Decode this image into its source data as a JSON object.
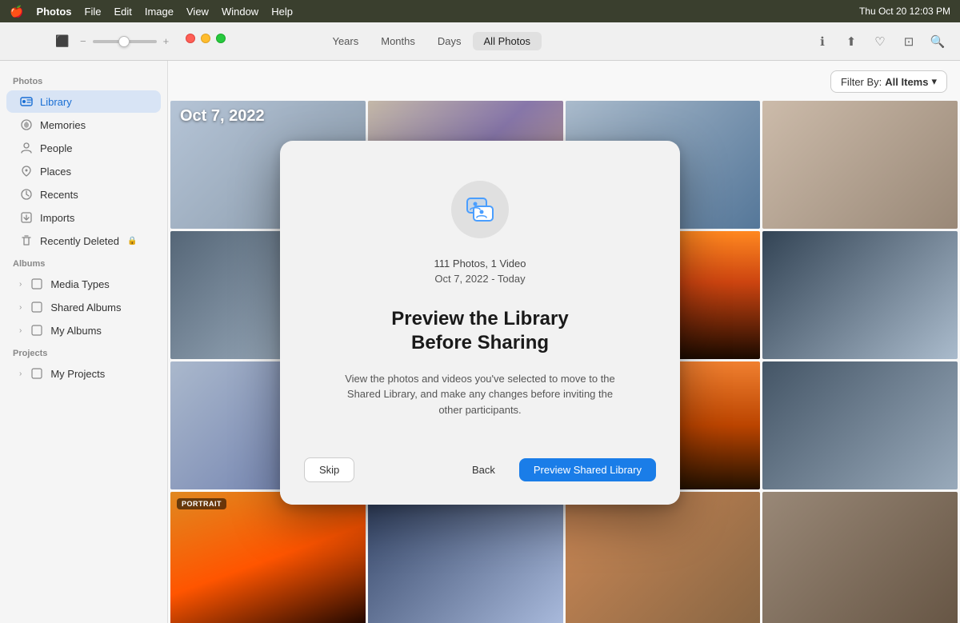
{
  "menubar": {
    "apple_icon": "🍎",
    "app_name": "Photos",
    "menus": [
      "File",
      "Edit",
      "Image",
      "View",
      "Window",
      "Help"
    ],
    "right_items": [
      "battery_icon",
      "wifi_icon",
      "control_center"
    ],
    "datetime": "Thu Oct 20  12:03 PM"
  },
  "toolbar": {
    "slider_label": "",
    "nav_items": [
      "Years",
      "Months",
      "Days",
      "All Photos"
    ],
    "active_nav": "All Photos",
    "filter_label": "Filter By:",
    "filter_value": "All Items"
  },
  "sidebar": {
    "photos_section": "Photos",
    "items_photos": [
      {
        "id": "library",
        "label": "Library",
        "icon": "📷",
        "active": true
      },
      {
        "id": "memories",
        "label": "Memories",
        "icon": "🌀"
      },
      {
        "id": "people",
        "label": "People",
        "icon": "👤"
      },
      {
        "id": "places",
        "label": "Places",
        "icon": "📍"
      },
      {
        "id": "recents",
        "label": "Recents",
        "icon": "🕐"
      },
      {
        "id": "imports",
        "label": "Imports",
        "icon": "📥"
      },
      {
        "id": "recently-deleted",
        "label": "Recently Deleted",
        "icon": "🗑️",
        "has_lock": true
      }
    ],
    "albums_section": "Albums",
    "items_albums": [
      {
        "id": "media-types",
        "label": "Media Types",
        "has_chevron": true
      },
      {
        "id": "shared-albums",
        "label": "Shared Albums",
        "has_chevron": true
      },
      {
        "id": "my-albums",
        "label": "My Albums",
        "has_chevron": true
      }
    ],
    "projects_section": "Projects",
    "items_projects": [
      {
        "id": "my-projects",
        "label": "My Projects",
        "has_chevron": true
      }
    ]
  },
  "photo_grid": {
    "date_label": "Oct 7, 2022",
    "portrait_badge": "PORTRAIT"
  },
  "modal": {
    "icon_alt": "shared-library-icon",
    "stats": "111 Photos, 1 Video",
    "date_range": "Oct 7, 2022 - Today",
    "title": "Preview the Library\nBefore Sharing",
    "title_line1": "Preview the Library",
    "title_line2": "Before Sharing",
    "description": "View the photos and videos you've selected to move to the Shared Library, and make any changes before inviting the other participants.",
    "btn_skip": "Skip",
    "btn_back": "Back",
    "btn_primary": "Preview Shared Library"
  }
}
